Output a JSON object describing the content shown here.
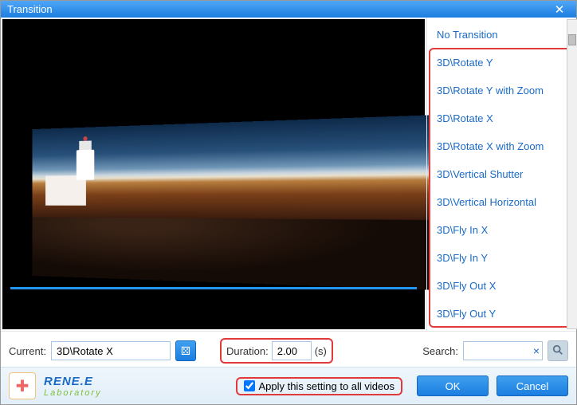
{
  "window": {
    "title": "Transition"
  },
  "transitions": {
    "no_transition": "No Transition",
    "items": [
      "3D\\Rotate Y",
      "3D\\Rotate Y with Zoom",
      "3D\\Rotate X",
      "3D\\Rotate X with Zoom",
      "3D\\Vertical Shutter",
      "3D\\Vertical Horizontal",
      "3D\\Fly In X",
      "3D\\Fly In Y",
      "3D\\Fly Out X",
      "3D\\Fly Out Y"
    ]
  },
  "controls": {
    "current_label": "Current:",
    "current_value": "3D\\Rotate X",
    "duration_label": "Duration:",
    "duration_value": "2.00",
    "duration_unit": "(s)",
    "search_label": "Search:",
    "search_value": ""
  },
  "footer": {
    "brand_line1": "RENE.E",
    "brand_line2": "Laboratory",
    "apply_label": "Apply this setting to all videos",
    "apply_checked": true,
    "ok": "OK",
    "cancel": "Cancel"
  }
}
